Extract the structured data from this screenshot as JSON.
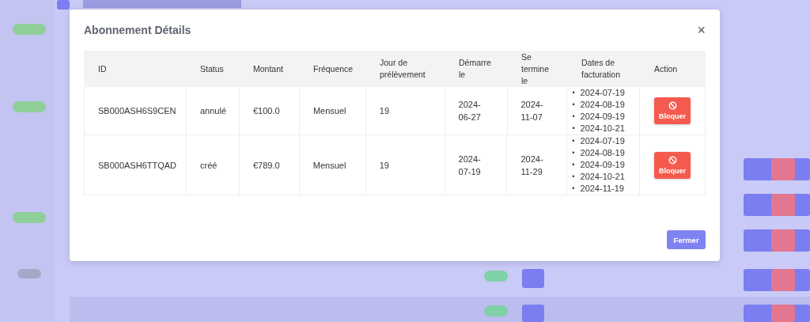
{
  "modal": {
    "title": "Abonnement Détails",
    "close": "×",
    "table": {
      "columns": [
        "ID",
        "Status",
        "Montant",
        "Fréquence",
        "Jour de prélèvement",
        "Démarre le",
        "Se termine le",
        "Dates de facturation",
        "Action"
      ],
      "rows": [
        {
          "id": "SB000ASH6S9CEN",
          "status": "annulé",
          "amount": "€100.0",
          "frequency": "Mensuel",
          "day": "19",
          "start": "2024-06-27",
          "end": "2024-11-07",
          "dates": [
            "2024-07-19",
            "2024-08-19",
            "2024-09-19",
            "2024-10-21"
          ],
          "action": "Bloquer"
        },
        {
          "id": "SB000ASH6TTQAD",
          "status": "créé",
          "amount": "€789.0",
          "frequency": "Mensuel",
          "day": "19",
          "start": "2024-07-19",
          "end": "2024-11-29",
          "dates": [
            "2024-07-19",
            "2024-08-19",
            "2024-09-19",
            "2024-10-21",
            "2024-11-19"
          ],
          "action": "Bloquer"
        }
      ]
    },
    "bullet": "•",
    "footer_button": "Fermer"
  }
}
